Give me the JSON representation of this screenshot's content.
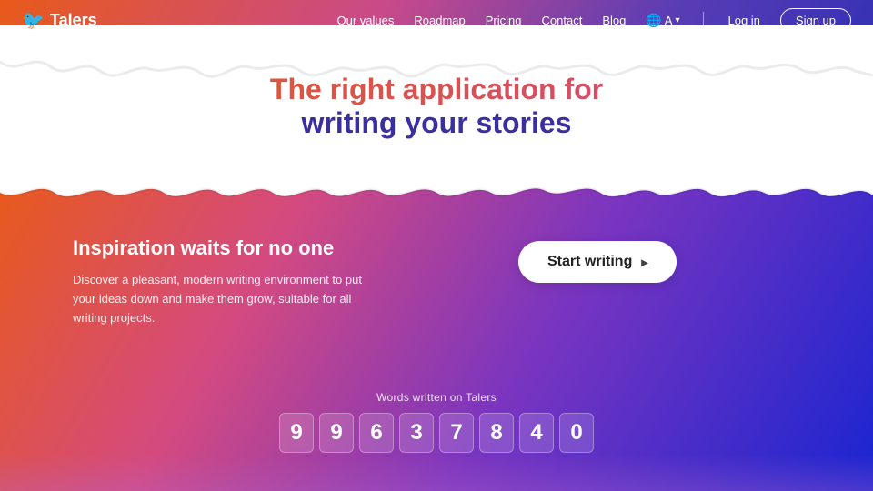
{
  "brand": {
    "name": "Talers",
    "bird_icon": "🐦"
  },
  "nav": {
    "links": [
      "Our values",
      "Roadmap",
      "Pricing",
      "Contact",
      "Blog"
    ],
    "lang_label": "A",
    "login_label": "Log in",
    "signup_label": "Sign up"
  },
  "hero": {
    "title_line1": "The right application for",
    "title_line2": "writing your stories"
  },
  "main": {
    "tagline": "Inspiration waits for no one",
    "description": "Discover a pleasant, modern writing environment to put your ideas down and make them grow, suitable for all writing projects."
  },
  "cta": {
    "label": "Start writing",
    "arrow": "▸"
  },
  "counter": {
    "label": "Words written on Talers",
    "digits": [
      "9",
      "9",
      "6",
      "3",
      "7",
      "8",
      "4",
      "0"
    ]
  },
  "colors": {
    "orange": "#e85a1a",
    "pink": "#c94a8a",
    "purple": "#5a3db5",
    "blue": "#2a2db5",
    "white": "#ffffff"
  }
}
